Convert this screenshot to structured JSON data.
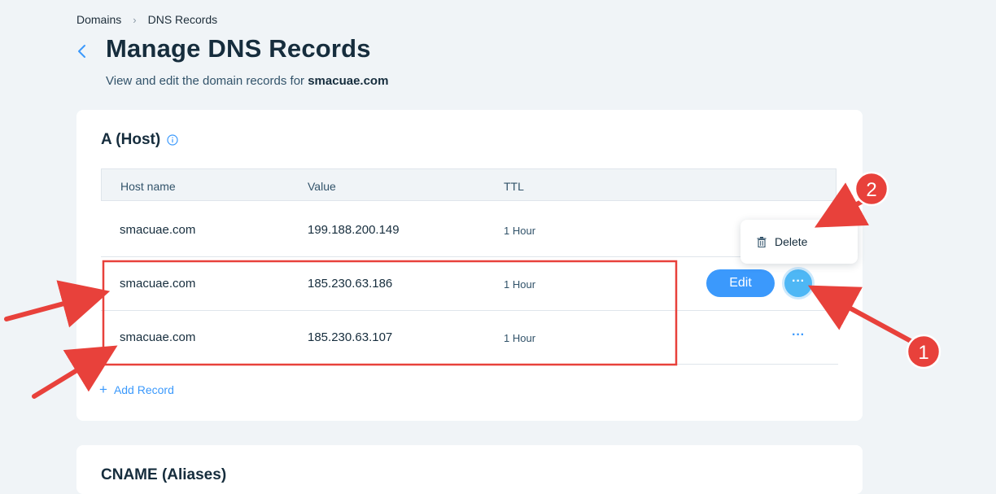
{
  "breadcrumb": {
    "items": [
      "Domains",
      "DNS Records"
    ]
  },
  "page": {
    "title": "Manage DNS Records",
    "subtitle_prefix": "View and edit the domain records for ",
    "domain": "smacuae.com"
  },
  "a_host": {
    "title": "A (Host)",
    "columns": [
      "Host name",
      "Value",
      "TTL"
    ],
    "rows": [
      {
        "host": "smacuae.com",
        "value": "199.188.200.149",
        "ttl": "1 Hour"
      },
      {
        "host": "smacuae.com",
        "value": "185.230.63.186",
        "ttl": "1 Hour"
      },
      {
        "host": "smacuae.com",
        "value": "185.230.63.107",
        "ttl": "1 Hour"
      }
    ],
    "edit_label": "Edit",
    "more_label": "···",
    "add_record_label": "Add Record"
  },
  "dropdown": {
    "delete_label": "Delete"
  },
  "cname": {
    "title": "CNAME (Aliases)"
  },
  "annotations": {
    "badge_1": "1",
    "badge_2": "2"
  },
  "colors": {
    "accent": "#3b99fc",
    "annotation_red": "#e8413b",
    "background": "#f0f4f7"
  },
  "icons": [
    "chevron-right-icon",
    "chevron-left-icon",
    "info-icon",
    "plus-icon",
    "trash-icon",
    "more-icon"
  ]
}
